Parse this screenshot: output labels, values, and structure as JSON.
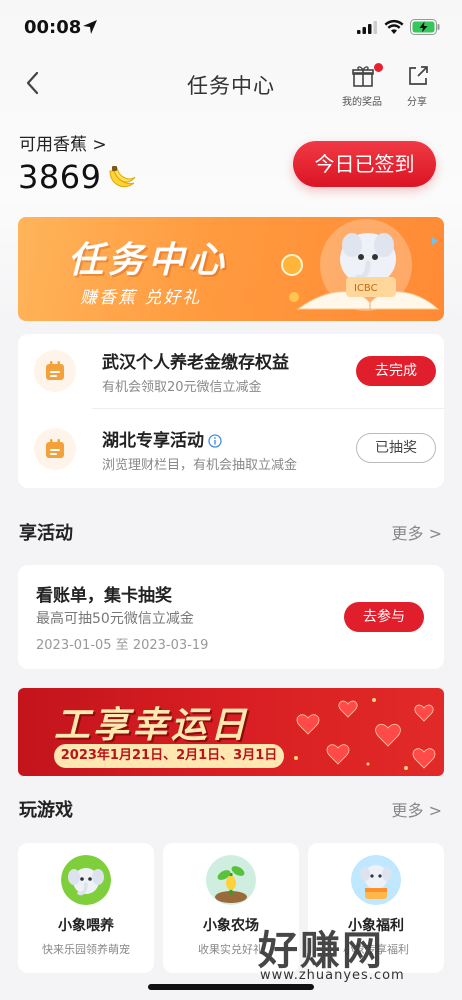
{
  "status_bar": {
    "time": "00:08"
  },
  "nav": {
    "title": "任务中心",
    "my_prizes_label": "我的奖品",
    "share_label": "分享"
  },
  "balance": {
    "label": "可用香蕉 >",
    "value": "3869",
    "signin_label": "今日已签到"
  },
  "task_banner": {
    "title": "任务中心",
    "subtitle": "赚香蕉 兑好礼",
    "badge_text": "ICBC"
  },
  "tasks": [
    {
      "title": "武汉个人养老金缴存权益",
      "desc": "有机会领取20元微信立减金",
      "button": "去完成",
      "button_style": "primary"
    },
    {
      "title": "湖北专享活动",
      "desc": "浏览理财栏目，有机会抽取立减金",
      "button": "已抽奖",
      "button_style": "outline"
    }
  ],
  "activities_section": {
    "title": "享活动",
    "more": "更多 >"
  },
  "activity": {
    "title": "看账单，集卡抽奖",
    "desc": "最高可抽50元微信立减金",
    "date": "2023-01-05 至 2023-03-19",
    "button": "去参与"
  },
  "lucky_banner": {
    "title": "工享幸运日",
    "dates": "2023年1月21日、2月1日、3月1日"
  },
  "games_section": {
    "title": "玩游戏",
    "more": "更多 >"
  },
  "games": [
    {
      "name": "小象喂养",
      "desc": "快来乐园领养萌宠"
    },
    {
      "name": "小象农场",
      "desc": "收果实兑好礼"
    },
    {
      "name": "小象福利",
      "desc": "小象专享福利"
    }
  ],
  "watermark": {
    "big": "好赚网",
    "small": "www.zhuanyes.com"
  },
  "colors": {
    "accent_red": "#e01e2c",
    "orange": "#ff9a3f",
    "icon_orange": "#f5a13b"
  }
}
